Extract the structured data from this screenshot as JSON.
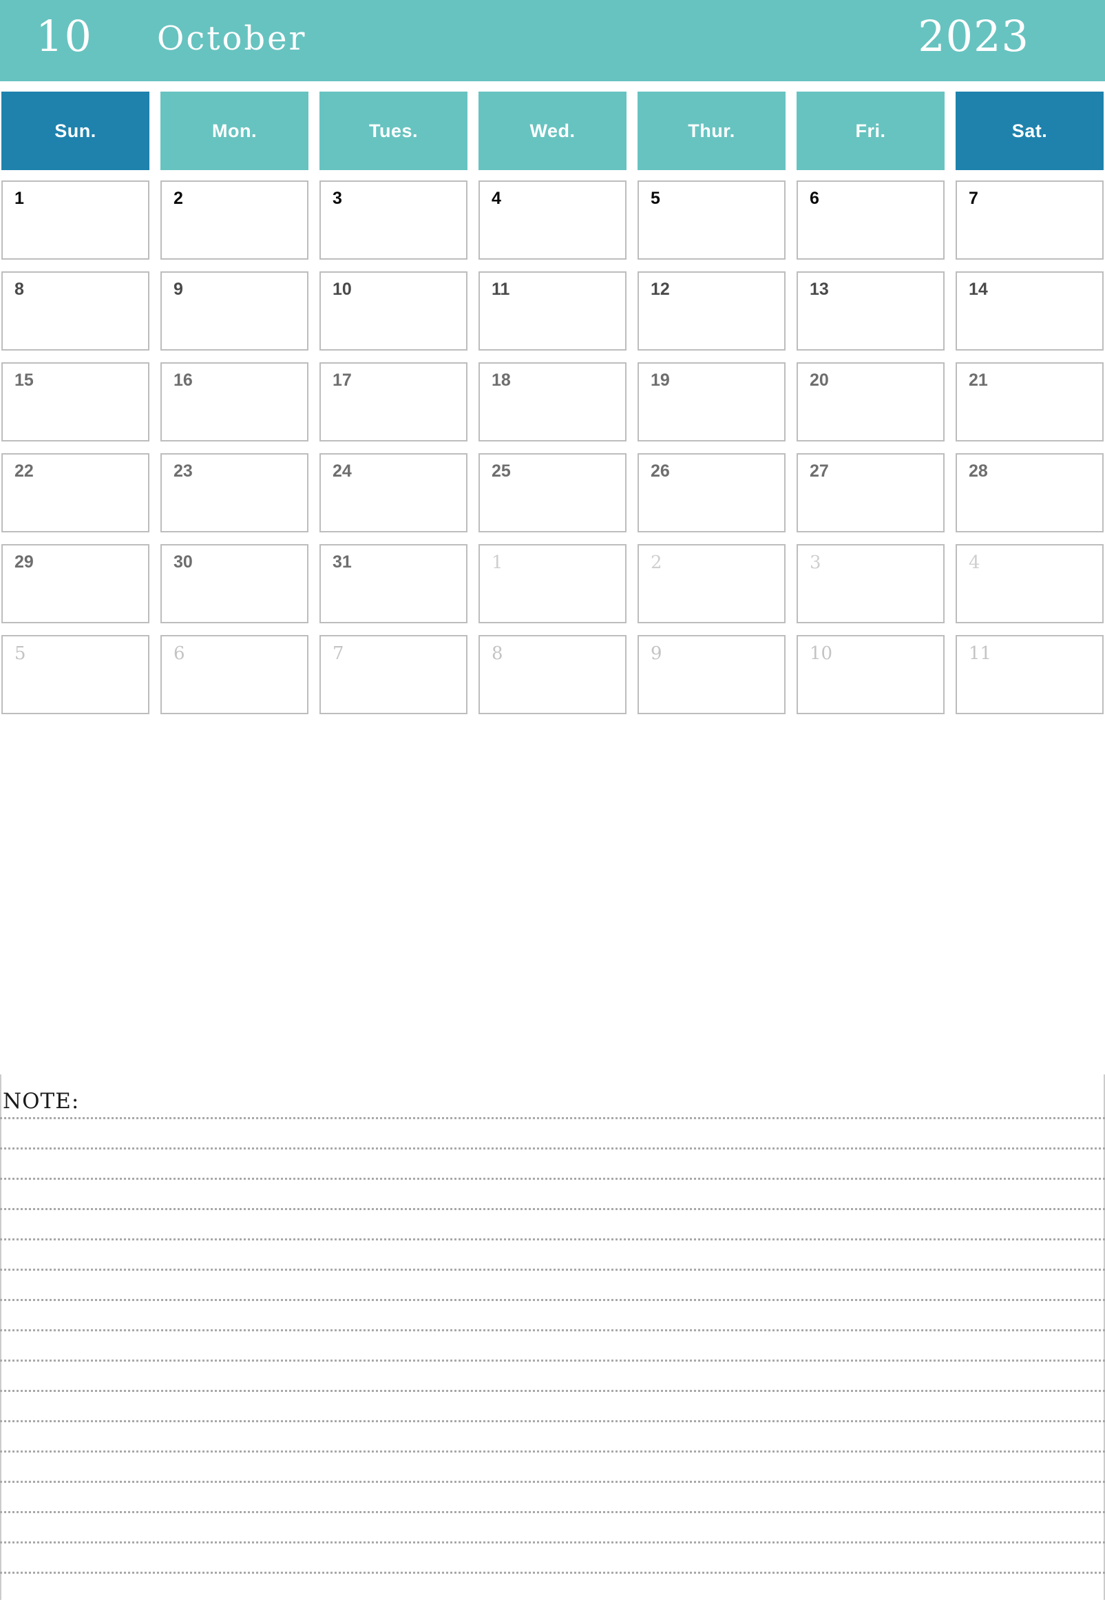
{
  "banner": {
    "month_number": "10",
    "month_name": "October",
    "year": "2023",
    "background_color": "#67c3c0",
    "text_color": "#ffffff"
  },
  "colors": {
    "teal": "#67c3c0",
    "weekend_blue": "#1e82ad",
    "cell_border": "#bdbdbd",
    "note_line": "#a8a8a8"
  },
  "weekdays": [
    {
      "label": "Sun.",
      "weekend": true
    },
    {
      "label": "Mon.",
      "weekend": false
    },
    {
      "label": "Tues.",
      "weekend": false
    },
    {
      "label": "Wed.",
      "weekend": false
    },
    {
      "label": "Thur.",
      "weekend": false
    },
    {
      "label": "Fri.",
      "weekend": false
    },
    {
      "label": "Sat.",
      "weekend": true
    }
  ],
  "weeks": [
    [
      {
        "day": "1",
        "other_month": false
      },
      {
        "day": "2",
        "other_month": false
      },
      {
        "day": "3",
        "other_month": false
      },
      {
        "day": "4",
        "other_month": false
      },
      {
        "day": "5",
        "other_month": false
      },
      {
        "day": "6",
        "other_month": false
      },
      {
        "day": "7",
        "other_month": false
      }
    ],
    [
      {
        "day": "8",
        "other_month": false
      },
      {
        "day": "9",
        "other_month": false
      },
      {
        "day": "10",
        "other_month": false
      },
      {
        "day": "11",
        "other_month": false
      },
      {
        "day": "12",
        "other_month": false
      },
      {
        "day": "13",
        "other_month": false
      },
      {
        "day": "14",
        "other_month": false
      }
    ],
    [
      {
        "day": "15",
        "other_month": false
      },
      {
        "day": "16",
        "other_month": false
      },
      {
        "day": "17",
        "other_month": false
      },
      {
        "day": "18",
        "other_month": false
      },
      {
        "day": "19",
        "other_month": false
      },
      {
        "day": "20",
        "other_month": false
      },
      {
        "day": "21",
        "other_month": false
      }
    ],
    [
      {
        "day": "22",
        "other_month": false
      },
      {
        "day": "23",
        "other_month": false
      },
      {
        "day": "24",
        "other_month": false
      },
      {
        "day": "25",
        "other_month": false
      },
      {
        "day": "26",
        "other_month": false
      },
      {
        "day": "27",
        "other_month": false
      },
      {
        "day": "28",
        "other_month": false
      }
    ],
    [
      {
        "day": "29",
        "other_month": false
      },
      {
        "day": "30",
        "other_month": false
      },
      {
        "day": "31",
        "other_month": false
      },
      {
        "day": "1",
        "other_month": true
      },
      {
        "day": "2",
        "other_month": true
      },
      {
        "day": "3",
        "other_month": true
      },
      {
        "day": "4",
        "other_month": true
      }
    ],
    [
      {
        "day": "5",
        "other_month": true
      },
      {
        "day": "6",
        "other_month": true
      },
      {
        "day": "7",
        "other_month": true
      },
      {
        "day": "8",
        "other_month": true
      },
      {
        "day": "9",
        "other_month": true
      },
      {
        "day": "10",
        "other_month": true
      },
      {
        "day": "11",
        "other_month": true
      }
    ]
  ],
  "note": {
    "label": "NOTE:",
    "line_count": 16
  }
}
